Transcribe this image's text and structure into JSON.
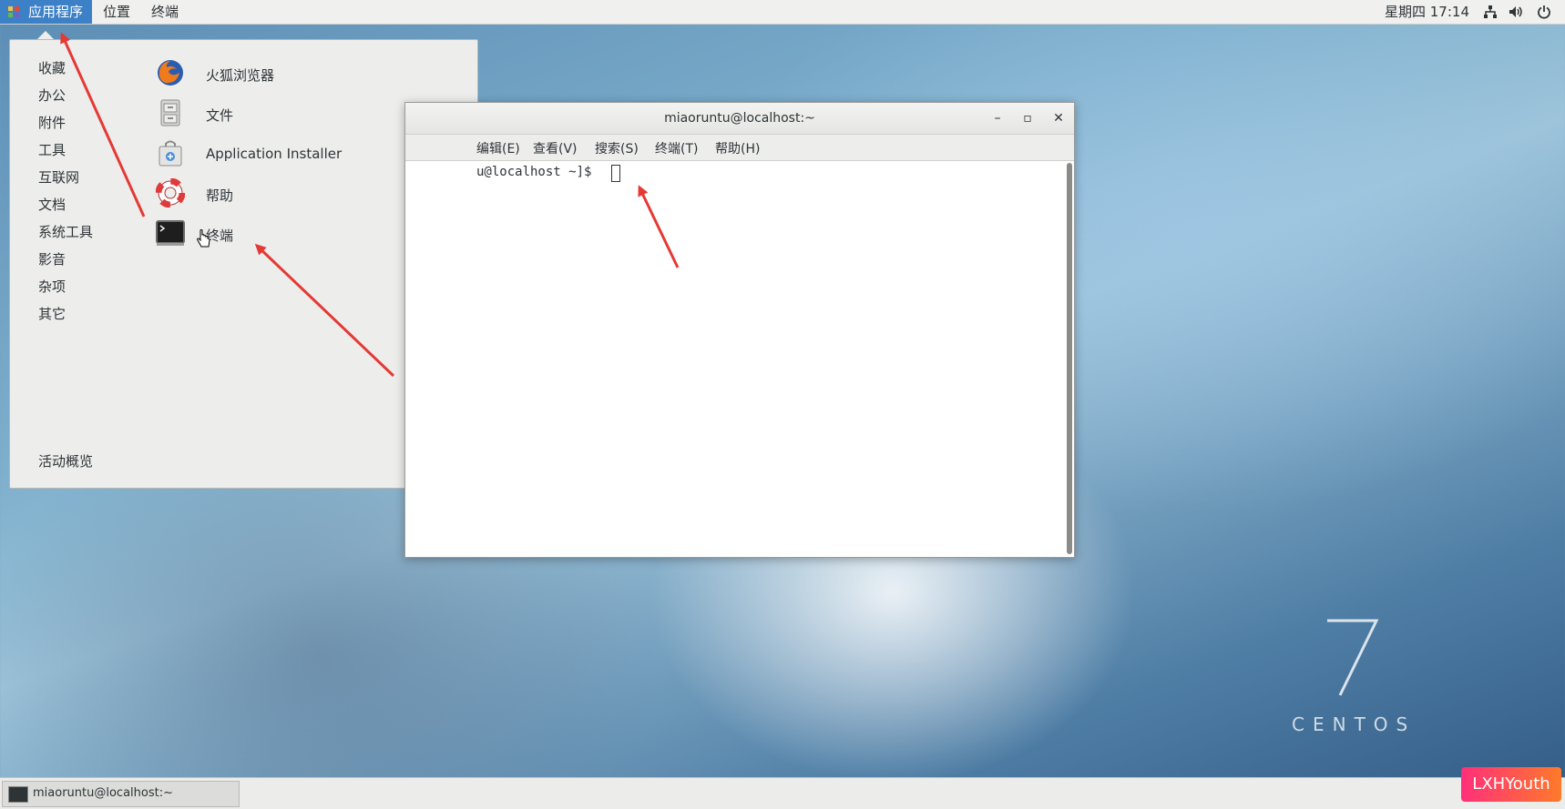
{
  "topbar": {
    "apps_label": "应用程序",
    "places_label": "位置",
    "terminal_label": "终端",
    "clock": "星期四 17:14",
    "icons": [
      "network-icon",
      "volume-icon",
      "power-icon"
    ]
  },
  "app_menu": {
    "categories": [
      "收藏",
      "办公",
      "附件",
      "工具",
      "互联网",
      "文档",
      "系统工具",
      "影音",
      "杂项",
      "其它"
    ],
    "activities_label": "活动概览",
    "apps": [
      {
        "label": "火狐浏览器",
        "icon": "firefox-icon"
      },
      {
        "label": "文件",
        "icon": "file-cabinet-icon"
      },
      {
        "label": "Application Installer",
        "icon": "installer-bag-icon"
      },
      {
        "label": "帮助",
        "icon": "lifebuoy-icon"
      },
      {
        "label": "终端",
        "icon": "terminal-icon"
      }
    ]
  },
  "terminal_window": {
    "title": "miaoruntu@localhost:~",
    "menu": [
      "编辑(E)",
      "查看(V)",
      "搜索(S)",
      "终端(T)",
      "帮助(H)"
    ],
    "prompt": "u@localhost ~]$ "
  },
  "desktop": {
    "logo_text": "CENTOS"
  },
  "taskbar": {
    "task_label": "miaoruntu@localhost:~"
  },
  "watermark": "LXHYouth",
  "colors": {
    "topbar_active": "#3c80c8",
    "annotation_arrow": "#e53935",
    "badge_start": "#ff2f7a",
    "badge_end": "#ff7a2a"
  }
}
